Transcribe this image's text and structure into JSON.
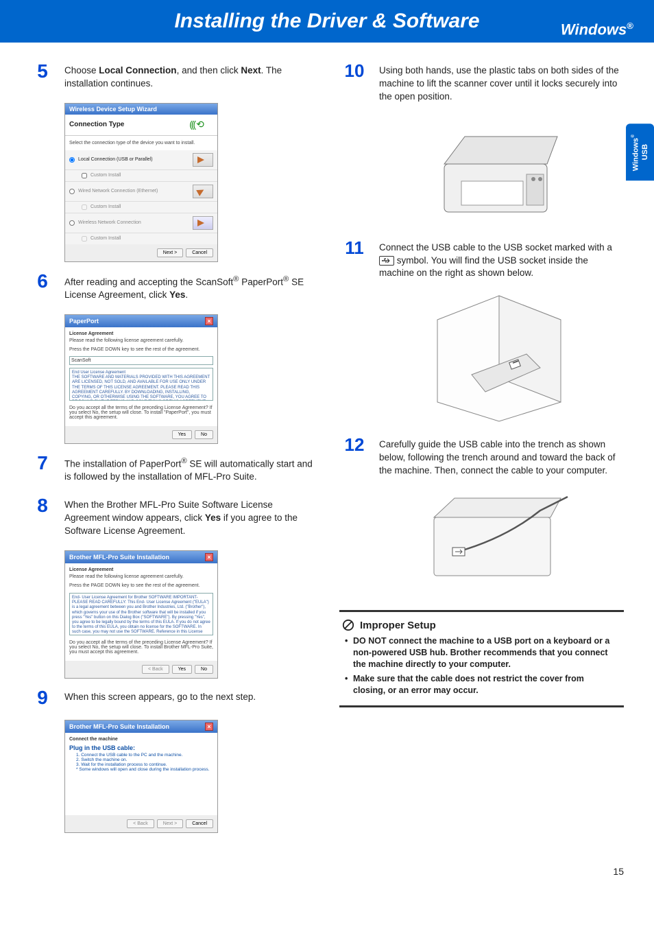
{
  "banner": {
    "title": "Installing the Driver & Software",
    "os_label": "Windows",
    "reg": "®"
  },
  "side_tab": {
    "line1": "Windows",
    "line2": "USB",
    "reg": "®"
  },
  "page_number": "15",
  "steps": {
    "s5": {
      "num": "5",
      "pre": "Choose ",
      "bold1": "Local Connection",
      "mid": ", and then click ",
      "bold2": "Next",
      "post": ". The installation continues."
    },
    "s6": {
      "num": "6",
      "pre": "After reading and accepting the ScanSoft",
      "reg1": "®",
      "mid1": " PaperPort",
      "reg2": "®",
      "mid2": " SE License Agreement, click ",
      "bold1": "Yes",
      "post": "."
    },
    "s7": {
      "num": "7",
      "pre": "The installation of PaperPort",
      "reg1": "®",
      "post": " SE will automatically start and is followed by the installation of MFL-Pro Suite."
    },
    "s8": {
      "num": "8",
      "pre": "When the Brother MFL-Pro Suite Software License Agreement window appears, click ",
      "bold1": "Yes",
      "post": " if you agree to the Software License Agreement."
    },
    "s9": {
      "num": "9",
      "text": "When this screen appears, go to the next step."
    },
    "s10": {
      "num": "10",
      "text": "Using both hands, use the plastic tabs on both sides of the machine to lift the scanner cover until it locks securely into the open position."
    },
    "s11": {
      "num": "11",
      "pre": "Connect the USB cable to the USB socket marked with a ",
      "post": " symbol. You will find the USB socket inside the machine on the right as shown below."
    },
    "s12": {
      "num": "12",
      "text": "Carefully guide the USB cable into the trench as shown below, following the trench around and toward the back of the machine. Then, connect the cable to your computer."
    }
  },
  "dialog1": {
    "title": "Wireless Device Setup Wizard",
    "conn_type": "Connection Type",
    "instruct": "Select the connection type of the device you want to install.",
    "opt1": "Local Connection (USB or Parallel)",
    "opt1sub": "Custom Install",
    "opt2": "Wired Network Connection (Ethernet)",
    "opt2sub": "Custom Install",
    "opt3": "Wireless Network Connection",
    "opt3sub": "Custom Install",
    "next": "Next >",
    "cancel": "Cancel"
  },
  "dialog2": {
    "title": "PaperPort",
    "heading": "License Agreement",
    "instruct1": "Please read the following license agreement carefully.",
    "instruct2": "Press the PAGE DOWN key to see the rest of the agreement.",
    "brand": "ScanSoft",
    "lic_heading": "End User License Agreement",
    "lic_text": "THE SOFTWARE AND MATERIALS PROVIDED WITH THIS AGREEMENT ARE LICENSED, NOT SOLD, AND AVAILABLE FOR USE ONLY UNDER THE TERMS OF THIS LICENSE AGREEMENT. PLEASE READ THIS AGREEMENT CAREFULLY. BY DOWNLOADING, INSTALLING, COPYING, OR OTHERWISE USING THE SOFTWARE, YOU AGREE TO BE BOUND BY THE TERMS AND CONDITIONS OF THIS AGREEMENT AND BECOME A PARTY TO THIS AGREEMENT. IF YOU DO",
    "confirm": "Do you accept all the terms of the preceding License Agreement? If you select No, the setup will close. To install \"PaperPort\", you must accept this agreement.",
    "yes": "Yes",
    "no": "No"
  },
  "dialog3": {
    "title": "Brother MFL-Pro Suite Installation",
    "heading": "License Agreement",
    "instruct1": "Please read the following license agreement carefully.",
    "instruct2": "Press the PAGE DOWN key to see the rest of the agreement.",
    "lic_text": "End- User License Agreement for Brother SOFTWARE IMPORTANT- PLEASE READ CAREFULLY: This End- User License Agreement (\"EULA\") is a legal agreement between you and Brother Industries, Ltd. (\"Brother\"), which governs your use of the Brother software that will be installed if you press \"Yes\" button on this Dialog Box (\"SOFTWARE\"). By pressing \"Yes\", you agree to be legally bound by the terms of this EULA. If you do not agree to the terms of this EULA, you obtain no license for the SOFTWARE. In such case, you may not use the SOFTWARE. Reference in this License Agreement to \"SOFTWARE\" shall where the context permits also include the media upon which it is stored.",
    "confirm": "Do you accept all the terms of the preceding License Agreement? If you select No, the setup will close. To install Brother MFL-Pro Suite, you must accept this agreement.",
    "back": "< Back",
    "yes": "Yes",
    "no": "No"
  },
  "dialog4": {
    "title": "Brother MFL-Pro Suite Installation",
    "heading": "Connect the machine",
    "plug_heading": "Plug in the USB cable:",
    "l1": "1. Connect  the USB cable to the PC and the machine.",
    "l2": "2. Switch the machine on.",
    "l3": "3. Wait for the installation process to continue.",
    "note": "* Some windows will open and close during the installation process.",
    "back": "< Back",
    "next": "Next >",
    "cancel": "Cancel"
  },
  "improper": {
    "title": "Improper Setup",
    "b1": "DO NOT connect the machine to a USB port on a keyboard or a non-powered USB hub. Brother recommends that you connect the machine directly to your computer.",
    "b2": "Make sure that the cable does not restrict the cover from closing, or an error may occur."
  }
}
